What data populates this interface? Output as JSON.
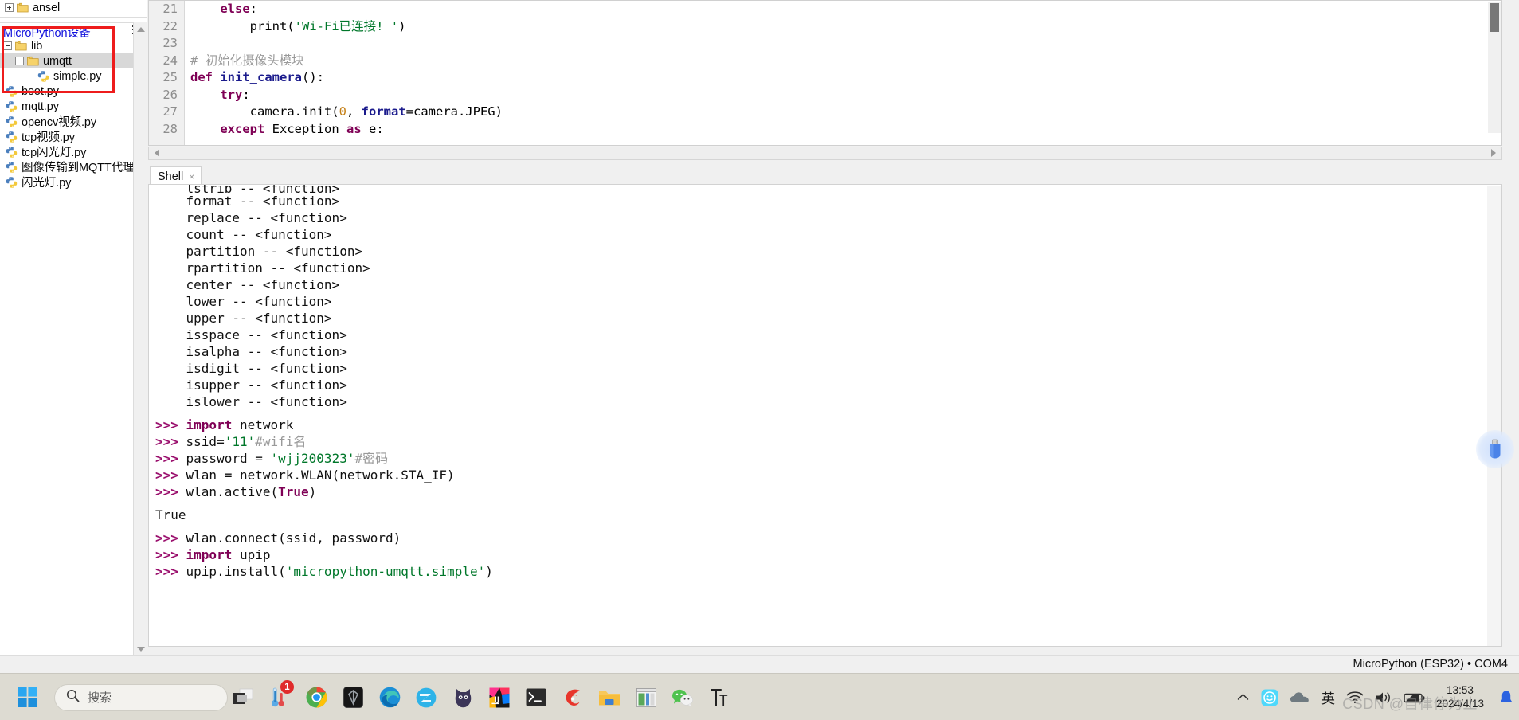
{
  "sidebar": {
    "local_files": [
      {
        "label": "ansel",
        "icon": "folder-icon",
        "expander": "plus",
        "indent": 0
      }
    ],
    "device_header": {
      "title": "MicroPython设备",
      "menu_icon": "hamburger-menu-icon"
    },
    "device_tree": [
      {
        "label": "lib",
        "icon": "folder-icon",
        "expander": "minus",
        "indent": 0,
        "selected": false
      },
      {
        "label": "umqtt",
        "icon": "folder-icon",
        "expander": "minus",
        "indent": 1,
        "selected": true
      },
      {
        "label": "simple.py",
        "icon": "python-file-icon",
        "expander": "none",
        "indent": 2,
        "selected": false
      },
      {
        "label": "boot.py",
        "icon": "python-file-icon",
        "expander": "none",
        "indent": 0,
        "selected": false
      },
      {
        "label": "mqtt.py",
        "icon": "python-file-icon",
        "expander": "none",
        "indent": 0,
        "selected": false
      },
      {
        "label": "opencv视频.py",
        "icon": "python-file-icon",
        "expander": "none",
        "indent": 0,
        "selected": false
      },
      {
        "label": "tcp视频.py",
        "icon": "python-file-icon",
        "expander": "none",
        "indent": 0,
        "selected": false
      },
      {
        "label": "tcp闪光灯.py",
        "icon": "python-file-icon",
        "expander": "none",
        "indent": 0,
        "selected": false
      },
      {
        "label": "图像传输到MQTT代理",
        "icon": "python-file-icon",
        "expander": "none",
        "indent": 0,
        "selected": false
      },
      {
        "label": "闪光灯.py",
        "icon": "python-file-icon",
        "expander": "none",
        "indent": 0,
        "selected": false
      }
    ],
    "annotation_color": "#ee1c1c"
  },
  "editor": {
    "lines": [
      {
        "num": "21",
        "text": "    else:"
      },
      {
        "num": "22",
        "text": "        print('Wi-Fi已连接! ')"
      },
      {
        "num": "23",
        "text": ""
      },
      {
        "num": "24",
        "text": "# 初始化摄像头模块"
      },
      {
        "num": "25",
        "text": "def init_camera():"
      },
      {
        "num": "26",
        "text": "    try:"
      },
      {
        "num": "27",
        "text": "        camera.init(0, format=camera.JPEG)"
      },
      {
        "num": "28",
        "text": "    except Exception as e:"
      }
    ]
  },
  "shell": {
    "tab_label": "Shell",
    "close_label": "×",
    "lines": [
      {
        "text": "    lstrip -- <function>",
        "kind": "clipped"
      },
      {
        "text": "    format -- <function>",
        "kind": "plain"
      },
      {
        "text": "    replace -- <function>",
        "kind": "plain"
      },
      {
        "text": "    count -- <function>",
        "kind": "plain"
      },
      {
        "text": "    partition -- <function>",
        "kind": "plain"
      },
      {
        "text": "    rpartition -- <function>",
        "kind": "plain"
      },
      {
        "text": "    center -- <function>",
        "kind": "plain"
      },
      {
        "text": "    lower -- <function>",
        "kind": "plain"
      },
      {
        "text": "    upper -- <function>",
        "kind": "plain"
      },
      {
        "text": "    isspace -- <function>",
        "kind": "plain"
      },
      {
        "text": "    isalpha -- <function>",
        "kind": "plain"
      },
      {
        "text": "    isdigit -- <function>",
        "kind": "plain"
      },
      {
        "text": "    isupper -- <function>",
        "kind": "plain"
      },
      {
        "text": "    islower -- <function>",
        "kind": "plain"
      },
      {
        "text": "",
        "kind": "gap"
      },
      {
        "text": ">>> import network",
        "kind": "input"
      },
      {
        "text": ">>> ssid='11'#wifi名",
        "kind": "input"
      },
      {
        "text": ">>> password = 'wjj200323'#密码",
        "kind": "input"
      },
      {
        "text": ">>> wlan = network.WLAN(network.STA_IF)",
        "kind": "input"
      },
      {
        "text": ">>> wlan.active(True)",
        "kind": "input"
      },
      {
        "text": "",
        "kind": "gap"
      },
      {
        "text": "True",
        "kind": "output"
      },
      {
        "text": "",
        "kind": "gap"
      },
      {
        "text": ">>> wlan.connect(ssid, password)",
        "kind": "input"
      },
      {
        "text": ">>> import upip",
        "kind": "input"
      },
      {
        "text": ">>> upip.install('micropython-umqtt.simple')",
        "kind": "input"
      }
    ]
  },
  "statusbar": {
    "interpreter": "MicroPython (ESP32)  •  COM4"
  },
  "taskbar": {
    "start_icon": "windows-start-icon",
    "search": {
      "placeholder": "搜索",
      "icon": "search-icon"
    },
    "apps": [
      {
        "name": "task-view-icon",
        "badge": ""
      },
      {
        "name": "thermometer-app-icon",
        "badge": "1"
      },
      {
        "name": "google-chrome-icon",
        "badge": ""
      },
      {
        "name": "dark-shield-app-icon",
        "badge": ""
      },
      {
        "name": "microsoft-edge-icon",
        "badge": ""
      },
      {
        "name": "edge-dev-icon",
        "badge": ""
      },
      {
        "name": "cat-app-icon",
        "badge": ""
      },
      {
        "name": "intellij-idea-icon",
        "badge": ""
      },
      {
        "name": "terminal-icon",
        "badge": ""
      },
      {
        "name": "thonny-icon",
        "badge": ""
      },
      {
        "name": "file-explorer-icon",
        "badge": ""
      },
      {
        "name": "presentation-app-icon",
        "badge": ""
      },
      {
        "name": "wechat-icon",
        "badge": ""
      },
      {
        "name": "font-tool-icon",
        "badge": ""
      }
    ],
    "tray": [
      {
        "name": "show-hidden-icons-chevron"
      },
      {
        "name": "smiley-app-tray-icon"
      },
      {
        "name": "onedrive-cloud-icon"
      },
      {
        "name": "ime-language-indicator",
        "label": "英"
      },
      {
        "name": "wifi-icon"
      },
      {
        "name": "volume-icon"
      },
      {
        "name": "battery-icon"
      }
    ],
    "clock": {
      "time": "13:53",
      "date": "2024/4/13"
    }
  },
  "overlays": {
    "usb_indicator_icon": "usb-drive-icon",
    "watermark": "CSDN @自律停为止"
  }
}
